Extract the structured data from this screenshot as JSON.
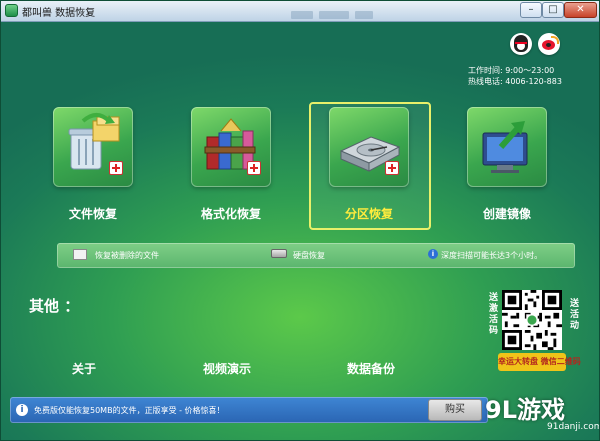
{
  "window": {
    "title": "都叫兽 数据恢复",
    "minimize": "–",
    "maximize": "□",
    "close": "✕"
  },
  "contact": {
    "work_hours": "工作时间: 9:00～23:00",
    "hotline": "热线电话: 4006-120-883"
  },
  "features": [
    {
      "label": "文件恢复",
      "icon": "recycle-bin-icon"
    },
    {
      "label": "格式化恢复",
      "icon": "winrar-books-icon"
    },
    {
      "label": "分区恢复",
      "icon": "hard-disk-icon",
      "selected": true
    },
    {
      "label": "创建镜像",
      "icon": "monitor-arrow-icon"
    }
  ],
  "info_bar": {
    "item1": "恢复被删除的文件",
    "item2": "硬盘恢复",
    "item3": "深度扫描可能长达3个小时。"
  },
  "others": {
    "title": "其他 ：",
    "links": [
      "关于",
      "视频演示",
      "数据备份"
    ]
  },
  "qr": {
    "left_text": "送激活码",
    "right_text": "送活动",
    "banner": "幸运大转盘 微信二维码"
  },
  "bottom_bar": {
    "notice": "免费版仅能恢复50MB的文件，正版享受 - 价格惊喜！",
    "buy_label": "购买"
  },
  "watermark": {
    "logo": "9L游戏",
    "url": "91danji.com"
  },
  "colors": {
    "background": "#2f9e52",
    "selected_label": "#ffec3d",
    "bottom_bar": "#2a65b3"
  }
}
